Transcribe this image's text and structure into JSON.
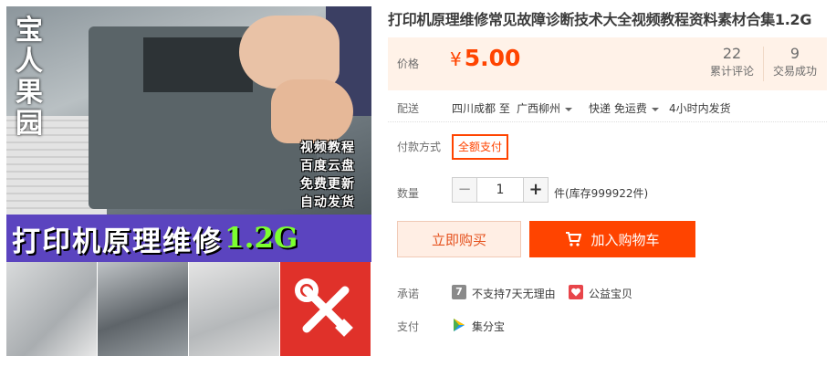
{
  "product": {
    "title": "打印机原理维修常见故障诊断技术大全视频教程资料素材合集1.2G"
  },
  "gallery": {
    "calligraphy": "宝人果园",
    "promo_lines": [
      "视频教程",
      "百度云盘",
      "免费更新",
      "自动发货"
    ],
    "banner_text": "打印机原理维修",
    "banner_size": "1.2G"
  },
  "price": {
    "label": "价格",
    "currency": "¥",
    "value": "5.00",
    "reviews_count": "22",
    "reviews_label": "累计评论",
    "sold_count": "9",
    "sold_label": "交易成功"
  },
  "delivery": {
    "label": "配送",
    "origin": "四川成都 至",
    "destination": "广西柳州",
    "shipping": "快递 免运费",
    "dispatch": "4小时内发货"
  },
  "payment_method": {
    "label": "付款方式",
    "option": "全额支付"
  },
  "quantity": {
    "label": "数量",
    "value": "1",
    "minus": "−",
    "plus": "+",
    "stock_text": "件(库存999922件)"
  },
  "actions": {
    "buy_now": "立即购买",
    "add_to_cart": "加入购物车"
  },
  "promise": {
    "label": "承诺",
    "no_return_badge": "7",
    "no_return_text": "不支持7天无理由",
    "charity_text": "公益宝贝"
  },
  "pay": {
    "label": "支付",
    "method_text": "集分宝"
  },
  "colors": {
    "accent": "#ff4400",
    "price_bg": "#fff2e8",
    "banner_purple": "#5b44bf"
  }
}
